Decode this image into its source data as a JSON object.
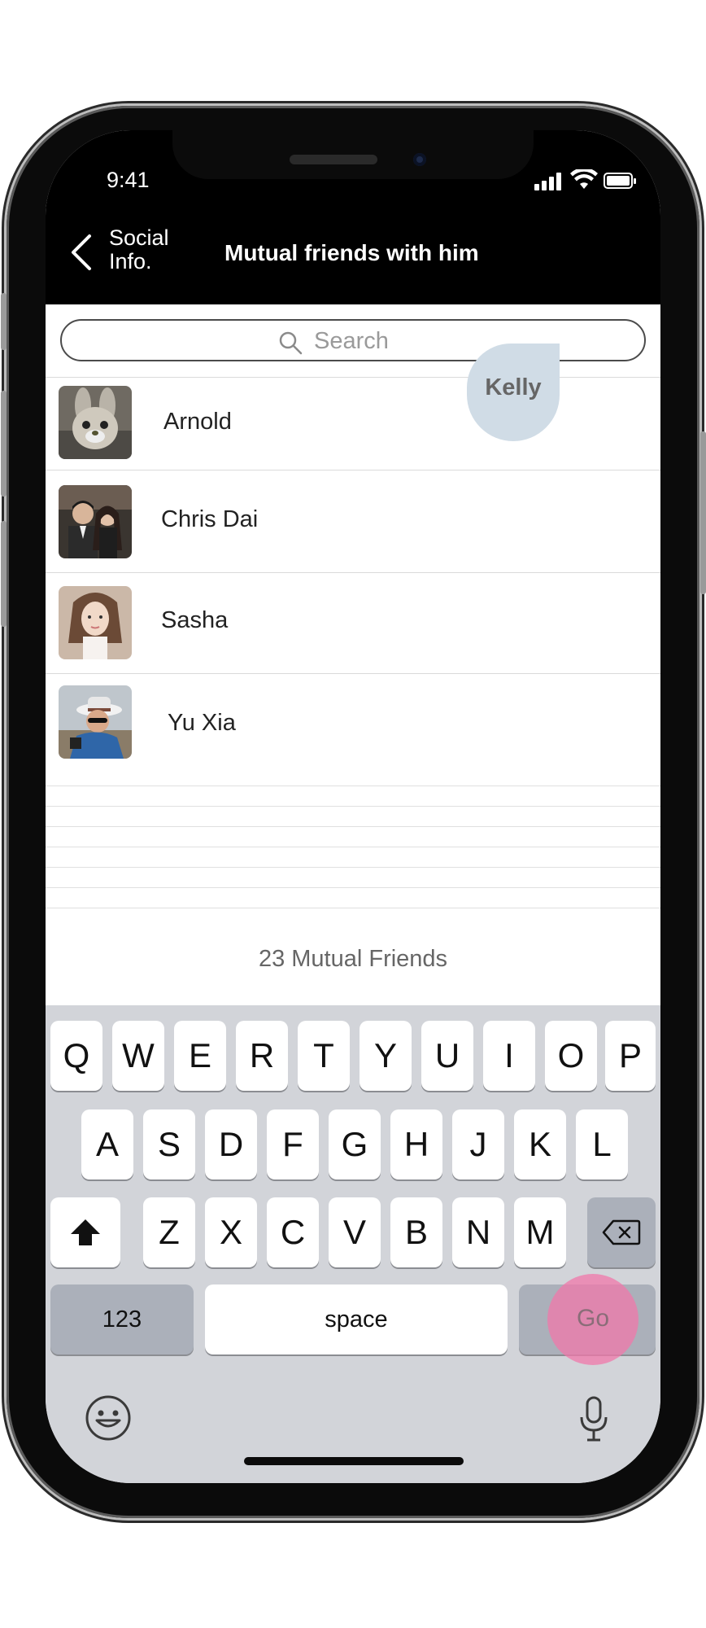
{
  "status_bar": {
    "time": "9:41"
  },
  "nav": {
    "back_label": "Social Info.",
    "title": "Mutual friends with him"
  },
  "search": {
    "placeholder": "Search",
    "value": ""
  },
  "touch_indicator": {
    "label": "Kelly"
  },
  "friends": [
    {
      "name": "Arnold",
      "avatar": "bunny-plush-avatar"
    },
    {
      "name": "Chris Dai",
      "avatar": "couple-photo-avatar"
    },
    {
      "name": "Sasha",
      "avatar": "woman-portrait-avatar"
    },
    {
      "name": "Yu Xia",
      "avatar": "man-white-hat-avatar"
    }
  ],
  "footer": {
    "count_text": "23 Mutual Friends"
  },
  "keyboard": {
    "row1": [
      "Q",
      "W",
      "E",
      "R",
      "T",
      "Y",
      "U",
      "I",
      "O",
      "P"
    ],
    "row2": [
      "A",
      "S",
      "D",
      "F",
      "G",
      "H",
      "J",
      "K",
      "L"
    ],
    "row3": [
      "Z",
      "X",
      "C",
      "V",
      "B",
      "N",
      "M"
    ],
    "numbers_label": "123",
    "space_label": "space",
    "go_label": "Go",
    "shift_icon": "shift-arrow-icon",
    "delete_icon": "backspace-icon",
    "emoji_icon": "emoji-face-icon",
    "mic_icon": "microphone-icon"
  },
  "colors": {
    "nav_background": "#000000",
    "keyboard_background": "#d2d4d9",
    "touch_bubble": "#d0dce6",
    "go_touch": "#f078aa"
  }
}
